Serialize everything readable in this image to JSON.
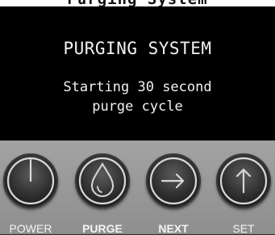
{
  "header": {
    "partial_title": "Purging System"
  },
  "display": {
    "title": "PURGING SYSTEM",
    "message_line1": "Starting 30 second",
    "message_line2": "purge cycle"
  },
  "controls": {
    "power": {
      "label": "POWER",
      "icon": "power-icon"
    },
    "purge": {
      "label": "PURGE",
      "icon": "droplet-icon"
    },
    "next": {
      "label": "NEXT",
      "icon": "arrow-right-icon"
    },
    "set": {
      "label": "SET",
      "icon": "arrow-up-icon"
    }
  },
  "colors": {
    "screen_bg": "#000000",
    "screen_text": "#f2f2f2",
    "panel_bg": "#9a9a9a",
    "button_bg": "#1e1e1e",
    "label_text": "#f4f4f4"
  }
}
